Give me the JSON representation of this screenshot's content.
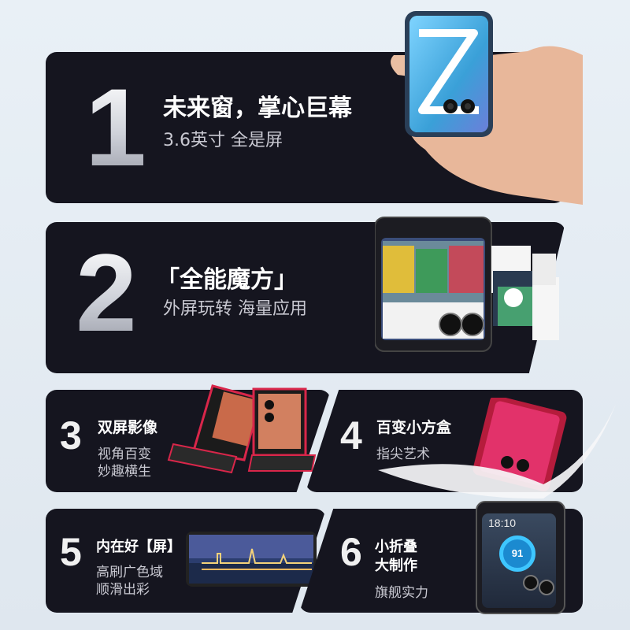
{
  "features": [
    {
      "number": "1",
      "title": "未来窗，掌心巨幕",
      "subtitle": "3.6英寸 全是屏"
    },
    {
      "number": "2",
      "title": "「全能魔方」",
      "subtitle": "外屏玩转 海量应用"
    },
    {
      "number": "3",
      "title": "双屏影像",
      "subtitle_line1": "视角百变",
      "subtitle_line2": "妙趣横生"
    },
    {
      "number": "4",
      "title": "百变小方盒",
      "subtitle": "指尖艺术"
    },
    {
      "number": "5",
      "title": "内在好【屏】",
      "subtitle_line1": "高刷广色域",
      "subtitle_line2": "顺滑出彩"
    },
    {
      "number": "6",
      "title_line1": "小折叠",
      "title_line2": "大制作",
      "subtitle": "旗舰实力"
    }
  ],
  "phone_screen": {
    "time": "18:10",
    "battery": "91"
  },
  "colors": {
    "card_bg": "#15151f",
    "page_bg": "#e4ecf3",
    "accent_blue": "#3ec6ff",
    "accent_red": "#d8264a"
  }
}
